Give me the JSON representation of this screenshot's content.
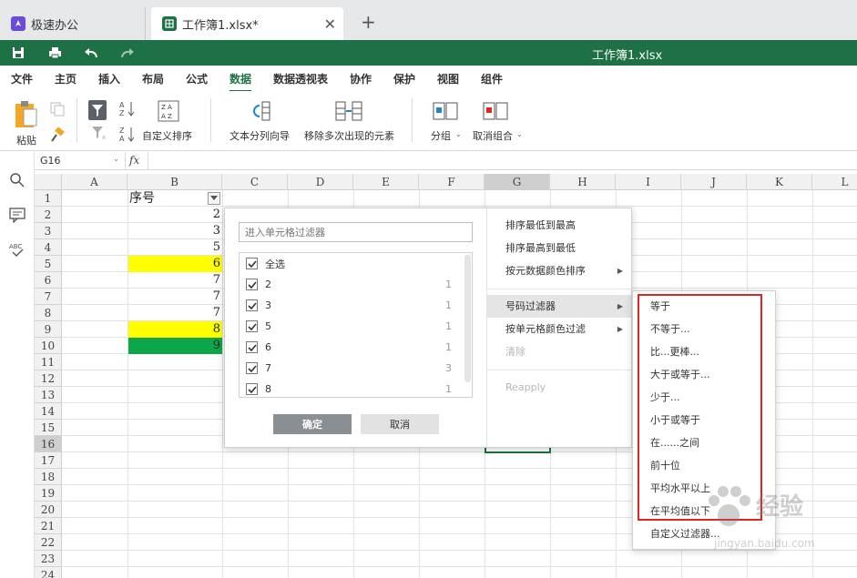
{
  "tabs": {
    "home": {
      "label": "极速办公",
      "icon": "rocket-icon"
    },
    "doc": {
      "label": "工作簿1.xlsx*",
      "icon": "spreadsheet-icon"
    }
  },
  "titlebar": {
    "title": "工作簿1.xlsx",
    "color": "#1e7145",
    "quick_icons": [
      "save-icon",
      "print-icon",
      "undo-icon",
      "redo-icon"
    ]
  },
  "menu": {
    "items": [
      "文件",
      "主页",
      "插入",
      "布局",
      "公式",
      "数据",
      "数据透视表",
      "协作",
      "保护",
      "视图",
      "组件"
    ],
    "active": "数据"
  },
  "ribbon": {
    "paste": "粘贴",
    "custom_sort": "自定义排序",
    "text_to_columns": "文本分列向导",
    "remove_duplicates": "移除多次出现的元素",
    "group": "分组",
    "ungroup": "取消组合",
    "az": "A Z",
    "za": "Z A"
  },
  "formula": {
    "namebox": "G16",
    "fx": "fx"
  },
  "sheet": {
    "columns": [
      "A",
      "B",
      "C",
      "D",
      "E",
      "F",
      "G",
      "H",
      "I",
      "J",
      "K",
      "L"
    ],
    "selected_column": "G",
    "rows": [
      "1",
      "2",
      "3",
      "4",
      "5",
      "6",
      "7",
      "8",
      "9",
      "10",
      "11",
      "12",
      "13",
      "14",
      "15",
      "16",
      "17",
      "18",
      "19",
      "20",
      "21",
      "22",
      "23",
      "24"
    ],
    "selected_row": "16",
    "b1_header": "序号",
    "b_values": [
      "2",
      "3",
      "5",
      "6",
      "7",
      "7",
      "7",
      "8",
      "9"
    ],
    "highlight_colors": {
      "yellow": "#ffff00",
      "green": "#0da64a"
    }
  },
  "filter": {
    "search_placeholder": "进入单元格过滤器",
    "items": [
      {
        "label": "全选",
        "count": ""
      },
      {
        "label": "2",
        "count": "1"
      },
      {
        "label": "3",
        "count": "1"
      },
      {
        "label": "5",
        "count": "1"
      },
      {
        "label": "6",
        "count": "1"
      },
      {
        "label": "7",
        "count": "3"
      },
      {
        "label": "8",
        "count": "1"
      }
    ],
    "ok": "确定",
    "cancel": "取消",
    "sort_menu": [
      "排序最低到最高",
      "排序最高到最低",
      "按元数据颜色排序",
      "号码过滤器",
      "按单元格颜色过滤",
      "清除",
      "Reapply"
    ]
  },
  "submenu": {
    "items": [
      "等于",
      "不等于...",
      "比...更棒...",
      "大于或等于...",
      "少于...",
      "小于或等于",
      "在......之间",
      "前十位",
      "平均水平以上",
      "在平均值以下",
      "自定义过滤器..."
    ],
    "highlight_color": "#e02424"
  },
  "watermark": {
    "line1": "经验",
    "line2": "jingyan.baidu.com"
  }
}
